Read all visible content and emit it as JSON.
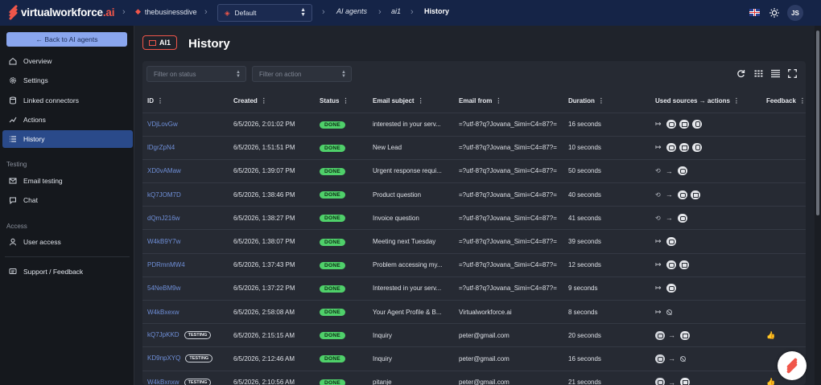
{
  "topbar": {
    "logo_main": "virtualworkforce",
    "logo_suffix": ".ai",
    "org": "thebusinessdive",
    "workspace": "Default",
    "crumb_agents": "AI agents",
    "crumb_agent": "ai1",
    "crumb_page": "History",
    "avatar_initials": "JS"
  },
  "sidebar": {
    "back_label": "← Back to AI agents",
    "items": [
      {
        "label": "Overview",
        "icon": "home-icon"
      },
      {
        "label": "Settings",
        "icon": "gear-icon"
      },
      {
        "label": "Linked connectors",
        "icon": "database-icon"
      },
      {
        "label": "Actions",
        "icon": "actions-icon"
      },
      {
        "label": "History",
        "icon": "list-icon"
      }
    ],
    "testing_label": "Testing",
    "testing_items": [
      {
        "label": "Email testing",
        "icon": "mail-icon"
      },
      {
        "label": "Chat",
        "icon": "chat-icon"
      }
    ],
    "access_label": "Access",
    "access_items": [
      {
        "label": "User access",
        "icon": "user-icon"
      }
    ],
    "support_label": "Support / Feedback"
  },
  "main": {
    "agent_badge": "AI1",
    "title": "History",
    "filter_status_placeholder": "Filter on status",
    "filter_action_placeholder": "Filter on action"
  },
  "table": {
    "columns": [
      "ID",
      "Created",
      "Status",
      "Email subject",
      "Email from",
      "Duration",
      "Used sources → actions",
      "Feedback"
    ],
    "rows": [
      {
        "id": "VDjLovGw",
        "testing": "",
        "created": "6/5/2026, 2:01:02 PM",
        "status": "DONE",
        "subject": "interested in your serv...",
        "from": "=?utf-8?q?Jovana_Simi=C4=87?=",
        "duration": "16 seconds",
        "sources": [
          "lr",
          "ai",
          "mail",
          "doc"
        ],
        "feedback": ""
      },
      {
        "id": "lDgrZpN4",
        "testing": "",
        "created": "6/5/2026, 1:51:51 PM",
        "status": "DONE",
        "subject": "New Lead",
        "from": "=?utf-8?q?Jovana_Simi=C4=87?=",
        "duration": "10 seconds",
        "sources": [
          "lr",
          "ai",
          "mail",
          "doc"
        ],
        "feedback": ""
      },
      {
        "id": "XD0vAMaw",
        "testing": "",
        "created": "6/5/2026, 1:39:07 PM",
        "status": "DONE",
        "subject": "Urgent response requi...",
        "from": "=?utf-8?q?Jovana_Simi=C4=87?=",
        "duration": "50 seconds",
        "sources": [
          "hist",
          "r",
          "ai"
        ],
        "feedback": ""
      },
      {
        "id": "kQ7JOM7D",
        "testing": "",
        "created": "6/5/2026, 1:38:46 PM",
        "status": "DONE",
        "subject": "Product question",
        "from": "=?utf-8?q?Jovana_Simi=C4=87?=",
        "duration": "40 seconds",
        "sources": [
          "hist",
          "r",
          "ai",
          "mail"
        ],
        "feedback": ""
      },
      {
        "id": "dQmJ216w",
        "testing": "",
        "created": "6/5/2026, 1:38:27 PM",
        "status": "DONE",
        "subject": "Invoice question",
        "from": "=?utf-8?q?Jovana_Simi=C4=87?=",
        "duration": "41 seconds",
        "sources": [
          "hist",
          "r",
          "ai"
        ],
        "feedback": ""
      },
      {
        "id": "W4kB9Y7w",
        "testing": "",
        "created": "6/5/2026, 1:38:07 PM",
        "status": "DONE",
        "subject": "Meeting next Tuesday",
        "from": "=?utf-8?q?Jovana_Simi=C4=87?=",
        "duration": "39 seconds",
        "sources": [
          "lr",
          "ai"
        ],
        "feedback": ""
      },
      {
        "id": "PDRmnMW4",
        "testing": "",
        "created": "6/5/2026, 1:37:43 PM",
        "status": "DONE",
        "subject": "Problem accessing my...",
        "from": "=?utf-8?q?Jovana_Simi=C4=87?=",
        "duration": "12 seconds",
        "sources": [
          "lr",
          "ai",
          "mail"
        ],
        "feedback": ""
      },
      {
        "id": "54NeBM9w",
        "testing": "",
        "created": "6/5/2026, 1:37:22 PM",
        "status": "DONE",
        "subject": "Interested in your serv...",
        "from": "=?utf-8?q?Jovana_Simi=C4=87?=",
        "duration": "9 seconds",
        "sources": [
          "lr",
          "ai"
        ],
        "feedback": ""
      },
      {
        "id": "W4kBxexw",
        "testing": "",
        "created": "6/5/2026, 2:58:08 AM",
        "status": "DONE",
        "subject": "Your Agent Profile & B...",
        "from": "Virtualworkforce.ai",
        "duration": "8 seconds",
        "sources": [
          "lr",
          "ban"
        ],
        "feedback": ""
      },
      {
        "id": "kQ7JpKKD",
        "testing": "TESTING",
        "created": "6/5/2026, 2:15:15 AM",
        "status": "DONE",
        "subject": "Inquiry",
        "from": "peter@gmail.com",
        "duration": "20 seconds",
        "sources": [
          "kb",
          "r",
          "mail"
        ],
        "feedback": "👍"
      },
      {
        "id": "KD9npXYQ",
        "testing": "TESTING",
        "created": "6/5/2026, 2:12:46 AM",
        "status": "DONE",
        "subject": "Inquiry",
        "from": "peter@gmail.com",
        "duration": "16 seconds",
        "sources": [
          "kb",
          "r",
          "ban"
        ],
        "feedback": ""
      },
      {
        "id": "W4kBxnxw",
        "testing": "TESTING",
        "created": "6/5/2026, 2:10:56 AM",
        "status": "DONE",
        "subject": "pitanje",
        "from": "peter@gmail.com",
        "duration": "21 seconds",
        "sources": [
          "kb",
          "r",
          "mail"
        ],
        "feedback": "👍"
      }
    ]
  }
}
